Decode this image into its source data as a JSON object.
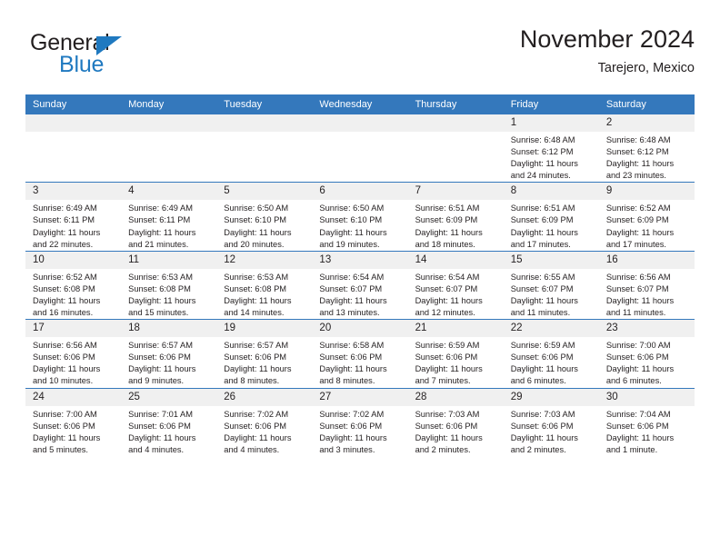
{
  "logo": {
    "word_general": "General",
    "word_blue": "Blue",
    "accent_color": "#1f79c0"
  },
  "header": {
    "title": "November 2024",
    "subtitle": "Tarejero, Mexico"
  },
  "calendar": {
    "header_bg": "#3478bc",
    "daynum_bg": "#f0f0f0",
    "weekdays": [
      "Sunday",
      "Monday",
      "Tuesday",
      "Wednesday",
      "Thursday",
      "Friday",
      "Saturday"
    ],
    "weeks": [
      [
        {
          "day": "",
          "sunrise": "",
          "sunset": "",
          "daylight_l1": "",
          "daylight_l2": ""
        },
        {
          "day": "",
          "sunrise": "",
          "sunset": "",
          "daylight_l1": "",
          "daylight_l2": ""
        },
        {
          "day": "",
          "sunrise": "",
          "sunset": "",
          "daylight_l1": "",
          "daylight_l2": ""
        },
        {
          "day": "",
          "sunrise": "",
          "sunset": "",
          "daylight_l1": "",
          "daylight_l2": ""
        },
        {
          "day": "",
          "sunrise": "",
          "sunset": "",
          "daylight_l1": "",
          "daylight_l2": ""
        },
        {
          "day": "1",
          "sunrise": "Sunrise: 6:48 AM",
          "sunset": "Sunset: 6:12 PM",
          "daylight_l1": "Daylight: 11 hours",
          "daylight_l2": "and 24 minutes."
        },
        {
          "day": "2",
          "sunrise": "Sunrise: 6:48 AM",
          "sunset": "Sunset: 6:12 PM",
          "daylight_l1": "Daylight: 11 hours",
          "daylight_l2": "and 23 minutes."
        }
      ],
      [
        {
          "day": "3",
          "sunrise": "Sunrise: 6:49 AM",
          "sunset": "Sunset: 6:11 PM",
          "daylight_l1": "Daylight: 11 hours",
          "daylight_l2": "and 22 minutes."
        },
        {
          "day": "4",
          "sunrise": "Sunrise: 6:49 AM",
          "sunset": "Sunset: 6:11 PM",
          "daylight_l1": "Daylight: 11 hours",
          "daylight_l2": "and 21 minutes."
        },
        {
          "day": "5",
          "sunrise": "Sunrise: 6:50 AM",
          "sunset": "Sunset: 6:10 PM",
          "daylight_l1": "Daylight: 11 hours",
          "daylight_l2": "and 20 minutes."
        },
        {
          "day": "6",
          "sunrise": "Sunrise: 6:50 AM",
          "sunset": "Sunset: 6:10 PM",
          "daylight_l1": "Daylight: 11 hours",
          "daylight_l2": "and 19 minutes."
        },
        {
          "day": "7",
          "sunrise": "Sunrise: 6:51 AM",
          "sunset": "Sunset: 6:09 PM",
          "daylight_l1": "Daylight: 11 hours",
          "daylight_l2": "and 18 minutes."
        },
        {
          "day": "8",
          "sunrise": "Sunrise: 6:51 AM",
          "sunset": "Sunset: 6:09 PM",
          "daylight_l1": "Daylight: 11 hours",
          "daylight_l2": "and 17 minutes."
        },
        {
          "day": "9",
          "sunrise": "Sunrise: 6:52 AM",
          "sunset": "Sunset: 6:09 PM",
          "daylight_l1": "Daylight: 11 hours",
          "daylight_l2": "and 17 minutes."
        }
      ],
      [
        {
          "day": "10",
          "sunrise": "Sunrise: 6:52 AM",
          "sunset": "Sunset: 6:08 PM",
          "daylight_l1": "Daylight: 11 hours",
          "daylight_l2": "and 16 minutes."
        },
        {
          "day": "11",
          "sunrise": "Sunrise: 6:53 AM",
          "sunset": "Sunset: 6:08 PM",
          "daylight_l1": "Daylight: 11 hours",
          "daylight_l2": "and 15 minutes."
        },
        {
          "day": "12",
          "sunrise": "Sunrise: 6:53 AM",
          "sunset": "Sunset: 6:08 PM",
          "daylight_l1": "Daylight: 11 hours",
          "daylight_l2": "and 14 minutes."
        },
        {
          "day": "13",
          "sunrise": "Sunrise: 6:54 AM",
          "sunset": "Sunset: 6:07 PM",
          "daylight_l1": "Daylight: 11 hours",
          "daylight_l2": "and 13 minutes."
        },
        {
          "day": "14",
          "sunrise": "Sunrise: 6:54 AM",
          "sunset": "Sunset: 6:07 PM",
          "daylight_l1": "Daylight: 11 hours",
          "daylight_l2": "and 12 minutes."
        },
        {
          "day": "15",
          "sunrise": "Sunrise: 6:55 AM",
          "sunset": "Sunset: 6:07 PM",
          "daylight_l1": "Daylight: 11 hours",
          "daylight_l2": "and 11 minutes."
        },
        {
          "day": "16",
          "sunrise": "Sunrise: 6:56 AM",
          "sunset": "Sunset: 6:07 PM",
          "daylight_l1": "Daylight: 11 hours",
          "daylight_l2": "and 11 minutes."
        }
      ],
      [
        {
          "day": "17",
          "sunrise": "Sunrise: 6:56 AM",
          "sunset": "Sunset: 6:06 PM",
          "daylight_l1": "Daylight: 11 hours",
          "daylight_l2": "and 10 minutes."
        },
        {
          "day": "18",
          "sunrise": "Sunrise: 6:57 AM",
          "sunset": "Sunset: 6:06 PM",
          "daylight_l1": "Daylight: 11 hours",
          "daylight_l2": "and 9 minutes."
        },
        {
          "day": "19",
          "sunrise": "Sunrise: 6:57 AM",
          "sunset": "Sunset: 6:06 PM",
          "daylight_l1": "Daylight: 11 hours",
          "daylight_l2": "and 8 minutes."
        },
        {
          "day": "20",
          "sunrise": "Sunrise: 6:58 AM",
          "sunset": "Sunset: 6:06 PM",
          "daylight_l1": "Daylight: 11 hours",
          "daylight_l2": "and 8 minutes."
        },
        {
          "day": "21",
          "sunrise": "Sunrise: 6:59 AM",
          "sunset": "Sunset: 6:06 PM",
          "daylight_l1": "Daylight: 11 hours",
          "daylight_l2": "and 7 minutes."
        },
        {
          "day": "22",
          "sunrise": "Sunrise: 6:59 AM",
          "sunset": "Sunset: 6:06 PM",
          "daylight_l1": "Daylight: 11 hours",
          "daylight_l2": "and 6 minutes."
        },
        {
          "day": "23",
          "sunrise": "Sunrise: 7:00 AM",
          "sunset": "Sunset: 6:06 PM",
          "daylight_l1": "Daylight: 11 hours",
          "daylight_l2": "and 6 minutes."
        }
      ],
      [
        {
          "day": "24",
          "sunrise": "Sunrise: 7:00 AM",
          "sunset": "Sunset: 6:06 PM",
          "daylight_l1": "Daylight: 11 hours",
          "daylight_l2": "and 5 minutes."
        },
        {
          "day": "25",
          "sunrise": "Sunrise: 7:01 AM",
          "sunset": "Sunset: 6:06 PM",
          "daylight_l1": "Daylight: 11 hours",
          "daylight_l2": "and 4 minutes."
        },
        {
          "day": "26",
          "sunrise": "Sunrise: 7:02 AM",
          "sunset": "Sunset: 6:06 PM",
          "daylight_l1": "Daylight: 11 hours",
          "daylight_l2": "and 4 minutes."
        },
        {
          "day": "27",
          "sunrise": "Sunrise: 7:02 AM",
          "sunset": "Sunset: 6:06 PM",
          "daylight_l1": "Daylight: 11 hours",
          "daylight_l2": "and 3 minutes."
        },
        {
          "day": "28",
          "sunrise": "Sunrise: 7:03 AM",
          "sunset": "Sunset: 6:06 PM",
          "daylight_l1": "Daylight: 11 hours",
          "daylight_l2": "and 2 minutes."
        },
        {
          "day": "29",
          "sunrise": "Sunrise: 7:03 AM",
          "sunset": "Sunset: 6:06 PM",
          "daylight_l1": "Daylight: 11 hours",
          "daylight_l2": "and 2 minutes."
        },
        {
          "day": "30",
          "sunrise": "Sunrise: 7:04 AM",
          "sunset": "Sunset: 6:06 PM",
          "daylight_l1": "Daylight: 11 hours",
          "daylight_l2": "and 1 minute."
        }
      ]
    ]
  }
}
